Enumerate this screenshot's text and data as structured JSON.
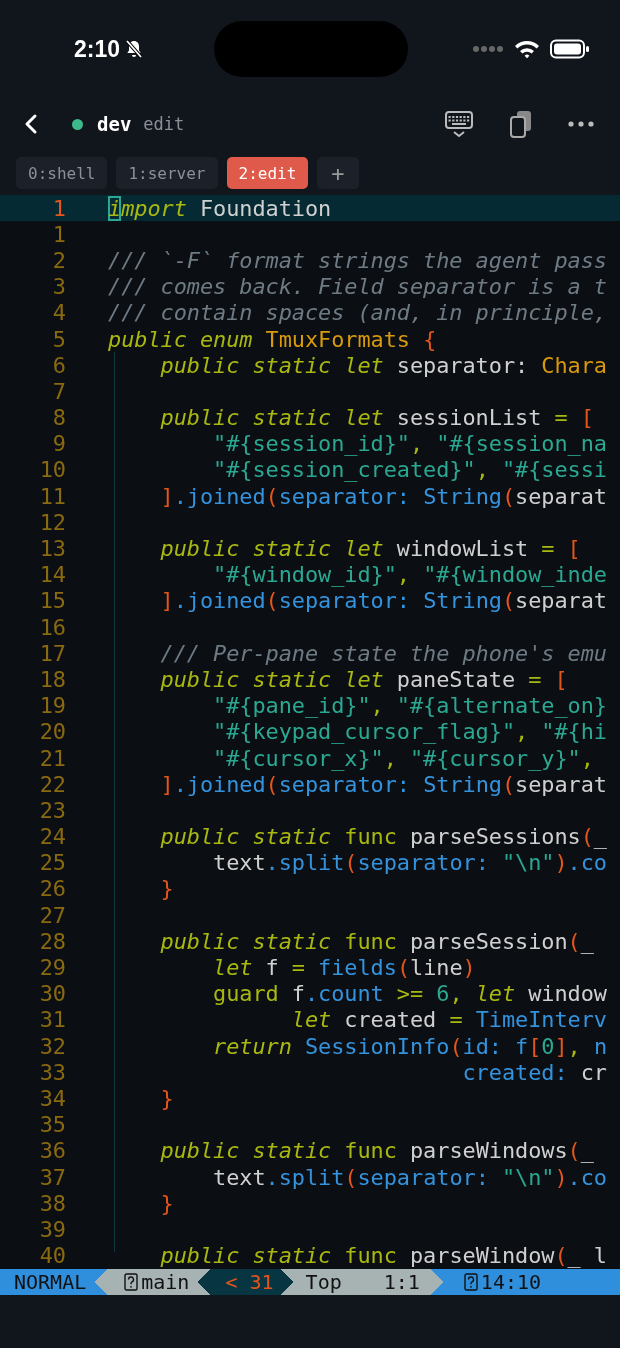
{
  "status_bar": {
    "time": "2:10"
  },
  "header": {
    "session": "dev",
    "window": "edit"
  },
  "tabs": [
    {
      "label": "0:shell",
      "selected": false
    },
    {
      "label": "1:server",
      "selected": false
    },
    {
      "label": "2:edit",
      "selected": true
    }
  ],
  "new_tab": {
    "label": "+"
  },
  "editor": {
    "lines": [
      {
        "number": "1",
        "current": true,
        "tokens": [
          {
            "kind": "kw",
            "text": "i",
            "cursor": true
          },
          {
            "kind": "kw",
            "text": "mport"
          },
          {
            "kind": "plain",
            "text": " Foundation"
          }
        ]
      },
      {
        "number": "1",
        "current": false
      },
      {
        "number": "2",
        "current": false,
        "tokens": [
          {
            "kind": "comment",
            "text": "/// `-F` format strings the agent pass"
          }
        ]
      },
      {
        "number": "3",
        "current": false,
        "tokens": [
          {
            "kind": "comment",
            "text": "/// comes back. Field separator is a t"
          }
        ]
      },
      {
        "number": "4",
        "current": false,
        "tokens": [
          {
            "kind": "comment",
            "text": "/// contain spaces (and, in principle,"
          }
        ]
      },
      {
        "number": "5",
        "current": false,
        "tokens": [
          {
            "kind": "kw",
            "text": "public enum "
          },
          {
            "kind": "type",
            "text": "TmuxFormats "
          },
          {
            "kind": "punct",
            "text": "{"
          }
        ]
      },
      {
        "number": "6",
        "current": false,
        "tokens": [
          {
            "kind": "kw",
            "text": "    public static let"
          },
          {
            "kind": "plain",
            "text": " separator: "
          },
          {
            "kind": "type",
            "text": "Chara"
          }
        ]
      },
      {
        "number": "7",
        "current": false
      },
      {
        "number": "8",
        "current": false,
        "tokens": [
          {
            "kind": "kw",
            "text": "    public static let"
          },
          {
            "kind": "plain",
            "text": " sessionList "
          },
          {
            "kind": "op",
            "text": "= "
          },
          {
            "kind": "punct",
            "text": "["
          }
        ]
      },
      {
        "number": "9",
        "current": false,
        "tokens": [
          {
            "kind": "str",
            "text": "        \"#{session_id}\""
          },
          {
            "kind": "op",
            "text": ", "
          },
          {
            "kind": "str",
            "text": "\"#{session_na"
          }
        ]
      },
      {
        "number": "10",
        "current": false,
        "tokens": [
          {
            "kind": "str",
            "text": "        \"#{session_created}\""
          },
          {
            "kind": "op",
            "text": ", "
          },
          {
            "kind": "str",
            "text": "\"#{sessi"
          }
        ]
      },
      {
        "number": "11",
        "current": false,
        "tokens": [
          {
            "kind": "punct",
            "text": "    ]"
          },
          {
            "kind": "fn",
            "text": ".joined"
          },
          {
            "kind": "punct",
            "text": "("
          },
          {
            "kind": "fn",
            "text": "separator: String"
          },
          {
            "kind": "punct",
            "text": "("
          },
          {
            "kind": "plain",
            "text": "separat"
          }
        ]
      },
      {
        "number": "12",
        "current": false
      },
      {
        "number": "13",
        "current": false,
        "tokens": [
          {
            "kind": "kw",
            "text": "    public static let"
          },
          {
            "kind": "plain",
            "text": " windowList "
          },
          {
            "kind": "op",
            "text": "= "
          },
          {
            "kind": "punct",
            "text": "["
          }
        ]
      },
      {
        "number": "14",
        "current": false,
        "tokens": [
          {
            "kind": "str",
            "text": "        \"#{window_id}\""
          },
          {
            "kind": "op",
            "text": ", "
          },
          {
            "kind": "str",
            "text": "\"#{window_inde"
          }
        ]
      },
      {
        "number": "15",
        "current": false,
        "tokens": [
          {
            "kind": "punct",
            "text": "    ]"
          },
          {
            "kind": "fn",
            "text": ".joined"
          },
          {
            "kind": "punct",
            "text": "("
          },
          {
            "kind": "fn",
            "text": "separator: String"
          },
          {
            "kind": "punct",
            "text": "("
          },
          {
            "kind": "plain",
            "text": "separat"
          }
        ]
      },
      {
        "number": "16",
        "current": false
      },
      {
        "number": "17",
        "current": false,
        "tokens": [
          {
            "kind": "comment",
            "text": "    /// Per-pane state the phone's emu"
          }
        ]
      },
      {
        "number": "18",
        "current": false,
        "tokens": [
          {
            "kind": "kw",
            "text": "    public static let"
          },
          {
            "kind": "plain",
            "text": " paneState "
          },
          {
            "kind": "op",
            "text": "= "
          },
          {
            "kind": "punct",
            "text": "["
          }
        ]
      },
      {
        "number": "19",
        "current": false,
        "tokens": [
          {
            "kind": "str",
            "text": "        \"#{pane_id}\""
          },
          {
            "kind": "op",
            "text": ", "
          },
          {
            "kind": "str",
            "text": "\"#{alternate_on}"
          }
        ]
      },
      {
        "number": "20",
        "current": false,
        "tokens": [
          {
            "kind": "str",
            "text": "        \"#{keypad_cursor_flag}\""
          },
          {
            "kind": "op",
            "text": ", "
          },
          {
            "kind": "str",
            "text": "\"#{hi"
          }
        ]
      },
      {
        "number": "21",
        "current": false,
        "tokens": [
          {
            "kind": "str",
            "text": "        \"#{cursor_x}\""
          },
          {
            "kind": "op",
            "text": ", "
          },
          {
            "kind": "str",
            "text": "\"#{cursor_y}\""
          },
          {
            "kind": "op",
            "text": ","
          }
        ]
      },
      {
        "number": "22",
        "current": false,
        "tokens": [
          {
            "kind": "punct",
            "text": "    ]"
          },
          {
            "kind": "fn",
            "text": ".joined"
          },
          {
            "kind": "punct",
            "text": "("
          },
          {
            "kind": "fn",
            "text": "separator: String"
          },
          {
            "kind": "punct",
            "text": "("
          },
          {
            "kind": "plain",
            "text": "separat"
          }
        ]
      },
      {
        "number": "23",
        "current": false
      },
      {
        "number": "24",
        "current": false,
        "tokens": [
          {
            "kind": "kw",
            "text": "    public static "
          },
          {
            "kind": "kw2",
            "text": "func"
          },
          {
            "kind": "plain",
            "text": " parseSessions"
          },
          {
            "kind": "punct",
            "text": "("
          },
          {
            "kind": "plain",
            "text": "_"
          }
        ]
      },
      {
        "number": "25",
        "current": false,
        "tokens": [
          {
            "kind": "plain",
            "text": "        text"
          },
          {
            "kind": "fn",
            "text": ".split"
          },
          {
            "kind": "punct",
            "text": "("
          },
          {
            "kind": "fn",
            "text": "separator: "
          },
          {
            "kind": "str",
            "text": "\"\\n\""
          },
          {
            "kind": "punct",
            "text": ")"
          },
          {
            "kind": "fn",
            "text": ".co"
          }
        ]
      },
      {
        "number": "26",
        "current": false,
        "tokens": [
          {
            "kind": "punct",
            "text": "    }"
          }
        ]
      },
      {
        "number": "27",
        "current": false
      },
      {
        "number": "28",
        "current": false,
        "tokens": [
          {
            "kind": "kw",
            "text": "    public static "
          },
          {
            "kind": "kw2",
            "text": "func"
          },
          {
            "kind": "plain",
            "text": " parseSession"
          },
          {
            "kind": "punct",
            "text": "("
          },
          {
            "kind": "plain",
            "text": "_"
          }
        ]
      },
      {
        "number": "29",
        "current": false,
        "tokens": [
          {
            "kind": "kw",
            "text": "        let"
          },
          {
            "kind": "plain",
            "text": " f "
          },
          {
            "kind": "op",
            "text": "= "
          },
          {
            "kind": "fn",
            "text": "fields"
          },
          {
            "kind": "punct",
            "text": "("
          },
          {
            "kind": "plain",
            "text": "line"
          },
          {
            "kind": "punct",
            "text": ")"
          }
        ]
      },
      {
        "number": "30",
        "current": false,
        "tokens": [
          {
            "kind": "kw2",
            "text": "        guard"
          },
          {
            "kind": "plain",
            "text": " f"
          },
          {
            "kind": "fn",
            "text": ".count "
          },
          {
            "kind": "op",
            "text": ">= "
          },
          {
            "kind": "num",
            "text": "6"
          },
          {
            "kind": "op",
            "text": ", "
          },
          {
            "kind": "kw",
            "text": "let"
          },
          {
            "kind": "plain",
            "text": " window"
          }
        ]
      },
      {
        "number": "31",
        "current": false,
        "tokens": [
          {
            "kind": "kw",
            "text": "              let"
          },
          {
            "kind": "plain",
            "text": " created "
          },
          {
            "kind": "op",
            "text": "= "
          },
          {
            "kind": "fn",
            "text": "TimeInterv"
          }
        ]
      },
      {
        "number": "32",
        "current": false,
        "tokens": [
          {
            "kind": "kw",
            "text": "        return "
          },
          {
            "kind": "fn",
            "text": "SessionInfo"
          },
          {
            "kind": "punct",
            "text": "("
          },
          {
            "kind": "fn",
            "text": "id: f"
          },
          {
            "kind": "punct",
            "text": "["
          },
          {
            "kind": "num",
            "text": "0"
          },
          {
            "kind": "punct",
            "text": "]"
          },
          {
            "kind": "op",
            "text": ", "
          },
          {
            "kind": "fn",
            "text": "n"
          }
        ]
      },
      {
        "number": "33",
        "current": false,
        "tokens": [
          {
            "kind": "fn",
            "text": "                           created:"
          },
          {
            "kind": "plain",
            "text": " cr"
          }
        ]
      },
      {
        "number": "34",
        "current": false,
        "tokens": [
          {
            "kind": "punct",
            "text": "    }"
          }
        ]
      },
      {
        "number": "35",
        "current": false
      },
      {
        "number": "36",
        "current": false,
        "tokens": [
          {
            "kind": "kw",
            "text": "    public static "
          },
          {
            "kind": "kw2",
            "text": "func"
          },
          {
            "kind": "plain",
            "text": " parseWindows"
          },
          {
            "kind": "punct",
            "text": "("
          },
          {
            "kind": "plain",
            "text": "_"
          }
        ]
      },
      {
        "number": "37",
        "current": false,
        "tokens": [
          {
            "kind": "plain",
            "text": "        text"
          },
          {
            "kind": "fn",
            "text": ".split"
          },
          {
            "kind": "punct",
            "text": "("
          },
          {
            "kind": "fn",
            "text": "separator: "
          },
          {
            "kind": "str",
            "text": "\"\\n\""
          },
          {
            "kind": "punct",
            "text": ")"
          },
          {
            "kind": "fn",
            "text": ".co"
          }
        ]
      },
      {
        "number": "38",
        "current": false,
        "tokens": [
          {
            "kind": "punct",
            "text": "    }"
          }
        ]
      },
      {
        "number": "39",
        "current": false
      },
      {
        "number": "40",
        "current": false,
        "tokens": [
          {
            "kind": "kw",
            "text": "    public static "
          },
          {
            "kind": "kw2",
            "text": "func"
          },
          {
            "kind": "plain",
            "text": " parseWindow"
          },
          {
            "kind": "punct",
            "text": "("
          },
          {
            "kind": "plain",
            "text": "_ l"
          }
        ]
      }
    ]
  },
  "statusline": {
    "mode": "NORMAL",
    "branch": "main",
    "diagnostics": "< 31",
    "position": "Top",
    "cursor": "1:1",
    "clock": "14:10"
  }
}
